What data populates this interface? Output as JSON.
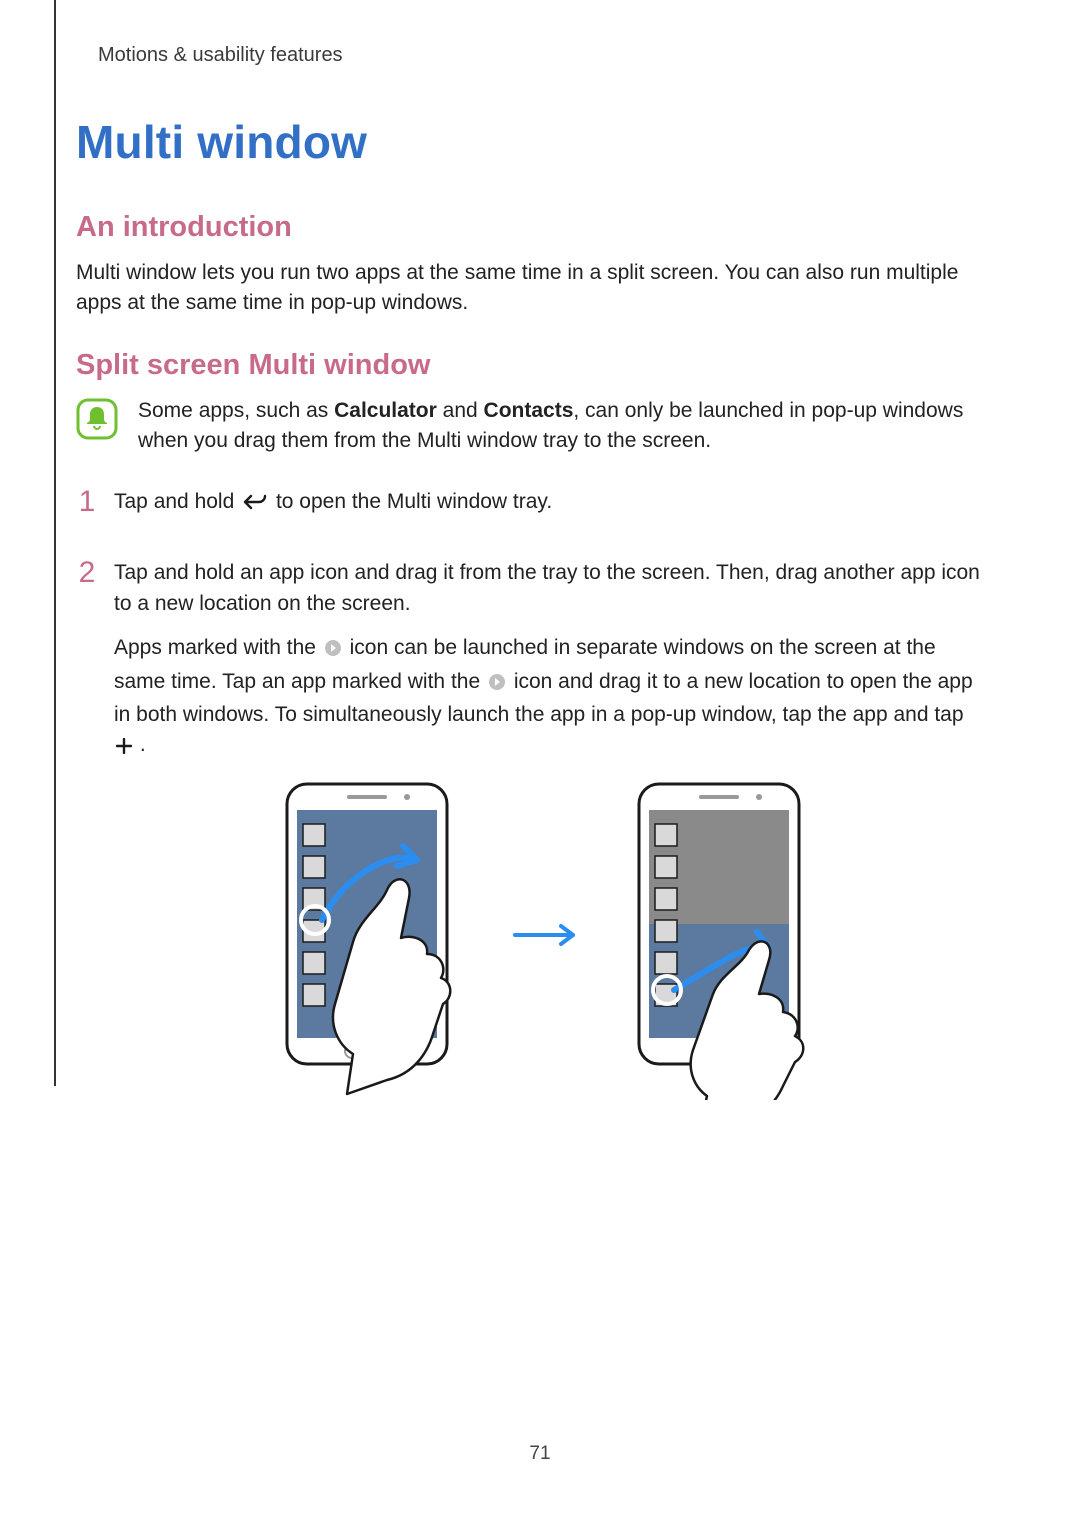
{
  "running_head": "Motions & usability features",
  "title": "Multi window",
  "sections": {
    "intro_heading": "An introduction",
    "intro_body": "Multi window lets you run two apps at the same time in a split screen. You can also run multiple apps at the same time in pop-up windows.",
    "split_heading": "Split screen Multi window"
  },
  "note": {
    "pre": "Some apps, such as ",
    "bold1": "Calculator",
    "mid": " and ",
    "bold2": "Contacts",
    "post": ", can only be launched in pop-up windows when you drag them from the Multi window tray to the screen."
  },
  "steps": {
    "s1": {
      "num": "1",
      "a": "Tap and hold ",
      "b": " to open the Multi window tray."
    },
    "s2": {
      "num": "2",
      "line1": "Tap and hold an app icon and drag it from the tray to the screen. Then, drag another app icon to a new location on the screen.",
      "p2_a": "Apps marked with the ",
      "p2_b": " icon can be launched in separate windows on the screen at the same time. Tap an app marked with the ",
      "p2_c": " icon and drag it to a new location to open the app in both windows. To simultaneously launch the app in a pop-up window, tap the app and tap ",
      "p2_d": "."
    }
  },
  "page_number": "71"
}
